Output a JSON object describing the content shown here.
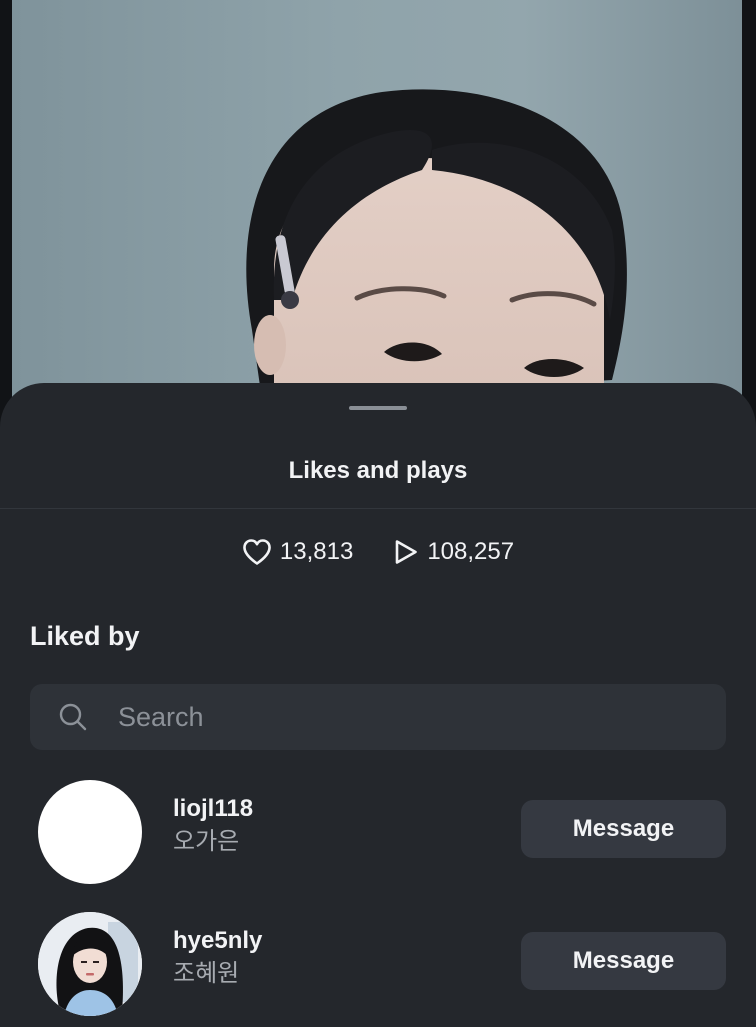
{
  "sheet": {
    "title": "Likes and plays",
    "likes_count": "13,813",
    "plays_count": "108,257",
    "liked_by_label": "Liked by",
    "search": {
      "placeholder": "Search",
      "value": ""
    },
    "users": [
      {
        "username": "liojl118",
        "full_name": "오가은",
        "button_label": "Message",
        "avatar": "blank-white-avatar"
      },
      {
        "username": "hye5nly",
        "full_name": "조혜원",
        "button_label": "Message",
        "avatar": "profile-photo"
      }
    ]
  },
  "icons": {
    "likes": "heart-icon",
    "plays": "play-icon",
    "search": "search-icon"
  },
  "colors": {
    "sheet_background": "#24272c",
    "button_background": "#353941",
    "search_background": "#2e3238",
    "primary_text": "#f2f3f5",
    "secondary_text": "#a7abb1"
  }
}
